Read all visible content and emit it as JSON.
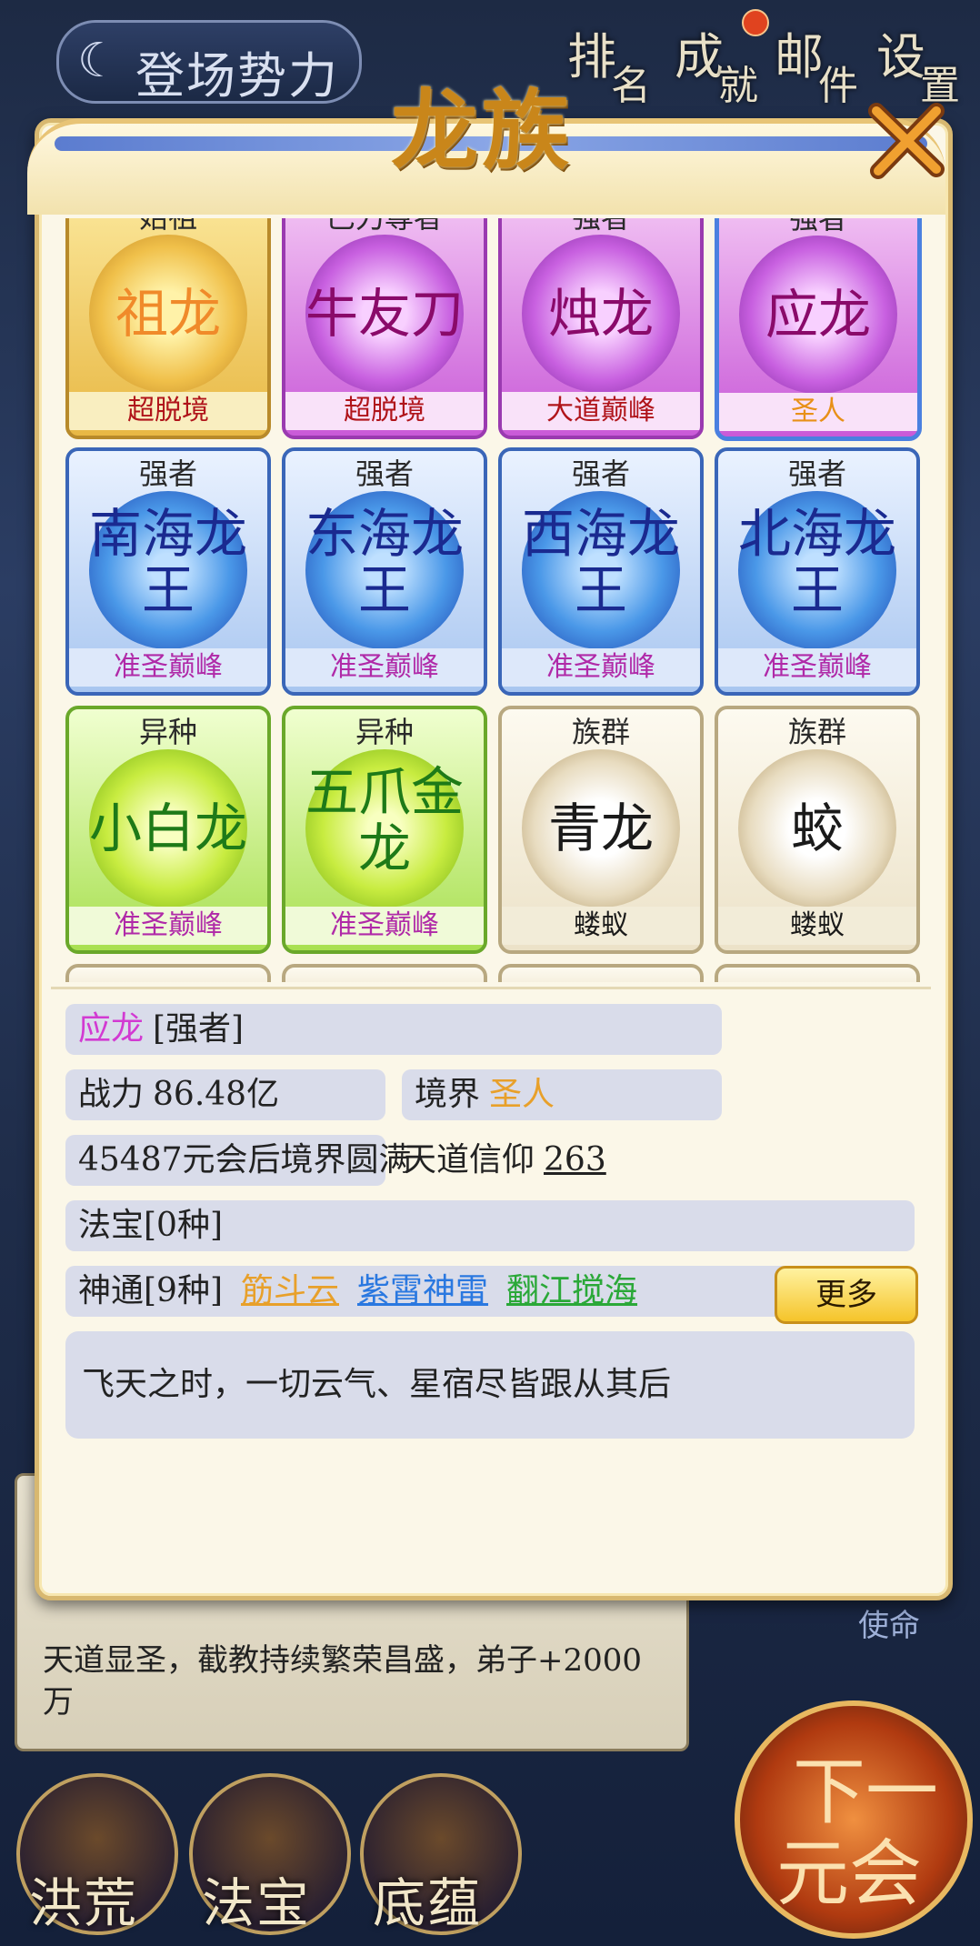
{
  "background": {
    "top_tab": "登场势力",
    "top_buttons": [
      {
        "main": "排",
        "sub": "名"
      },
      {
        "main": "成",
        "sub": "就"
      },
      {
        "main": "邮",
        "sub": "件"
      },
      {
        "main": "设",
        "sub": "置"
      }
    ],
    "card_era": "元会",
    "card_text": "天道显圣，截教持续繁荣昌盛，弟子+2000万",
    "mission": "使命",
    "bottom_buttons": [
      "洪荒",
      "法宝",
      "底蕴"
    ],
    "next_button": {
      "line1": "下一",
      "line2": "元会"
    }
  },
  "modal": {
    "title": "龙族",
    "close_icon": "close-x-icon"
  },
  "grid": [
    {
      "rank": "始祖",
      "name": "祖龙",
      "realm": "超脱境",
      "style": "gold"
    },
    {
      "rank": "巳刀尊者",
      "name": "牛友刀",
      "realm": "超脱境",
      "style": "purple"
    },
    {
      "rank": "强者",
      "name": "烛龙",
      "realm": "大道巅峰",
      "style": "purple"
    },
    {
      "rank": "强者",
      "name": "应龙",
      "realm": "圣人",
      "style": "purpleblue"
    },
    {
      "rank": "强者",
      "name": "南海龙王",
      "realm": "准圣巅峰",
      "style": "blue"
    },
    {
      "rank": "强者",
      "name": "东海龙王",
      "realm": "准圣巅峰",
      "style": "blue"
    },
    {
      "rank": "强者",
      "name": "西海龙王",
      "realm": "准圣巅峰",
      "style": "blue"
    },
    {
      "rank": "强者",
      "name": "北海龙王",
      "realm": "准圣巅峰",
      "style": "blue"
    },
    {
      "rank": "异种",
      "name": "小白龙",
      "realm": "准圣巅峰",
      "style": "green"
    },
    {
      "rank": "异种",
      "name": "五爪金龙",
      "realm": "准圣巅峰",
      "style": "green"
    },
    {
      "rank": "族群",
      "name": "青龙",
      "realm": "蝼蚁",
      "style": "cream"
    },
    {
      "rank": "族群",
      "name": "蛟",
      "realm": "蝼蚁",
      "style": "cream"
    }
  ],
  "detail": {
    "name": "应龙",
    "rank": "[强者]",
    "power_label": "战力",
    "power_value": "86.48亿",
    "realm_label": "境界",
    "realm_value": "圣人",
    "progress_text": "45487元会后境界圆满",
    "faith_label": "天道信仰",
    "faith_value": "263",
    "treasure": "法宝[0种]",
    "skills_label": "神通[9种]",
    "skills": [
      "筋斗云",
      "紫霄神雷",
      "翻江搅海"
    ],
    "more_button": "更多",
    "description": "飞天之时，一切云气、星宿尽皆跟从其后"
  },
  "colors": {
    "title": "#c9861a",
    "name_highlight": "#d23ad2",
    "realm_highlight": "#e8a02a",
    "skill_1": "#e8a02a",
    "skill_2": "#2a78e0",
    "skill_3": "#2aa838"
  }
}
